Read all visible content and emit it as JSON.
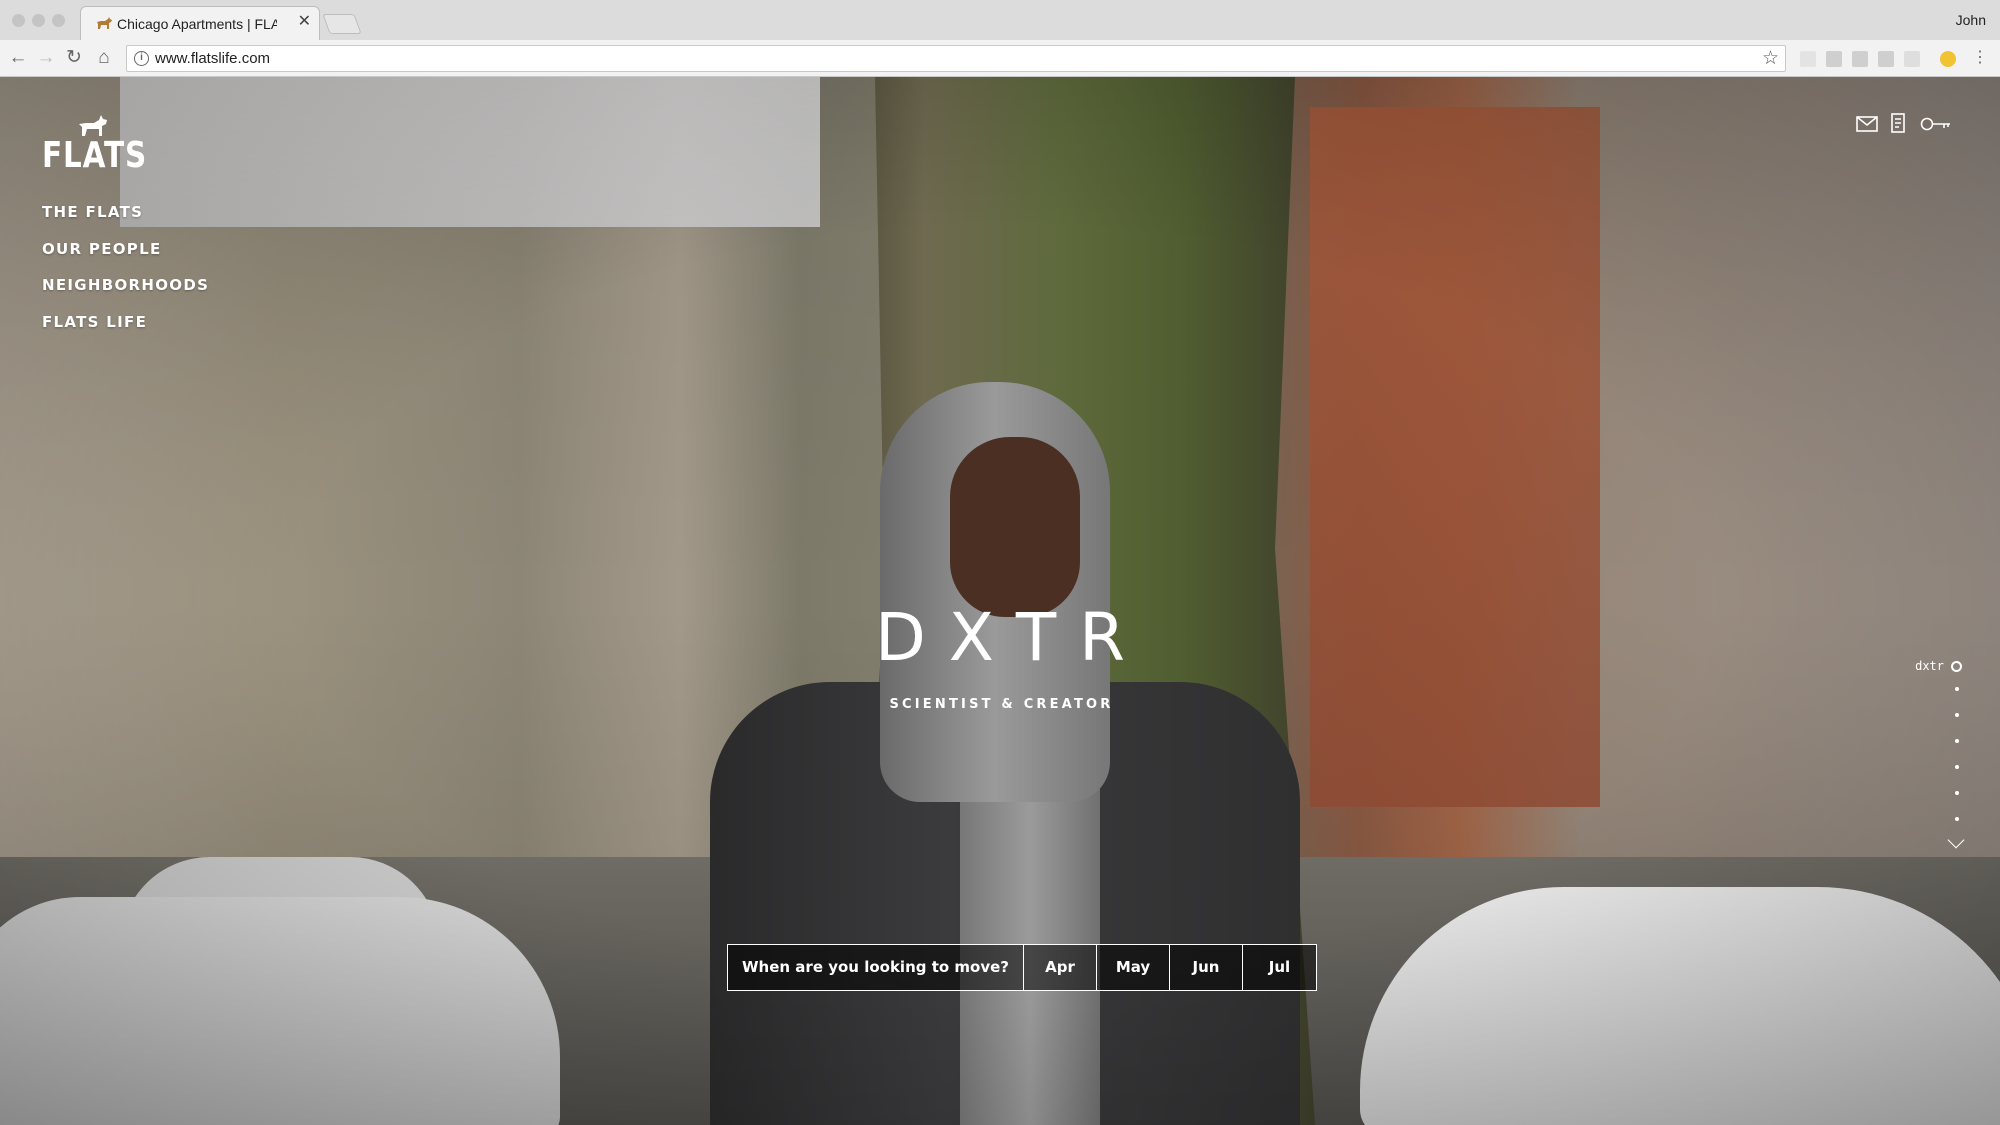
{
  "browser": {
    "tab_title": "Chicago Apartments | FLATS Chicago",
    "profile_name": "John",
    "url": "www.flatslife.com"
  },
  "site": {
    "logo_text": "FLATS",
    "nav": [
      {
        "label": "THE FLATS"
      },
      {
        "label": "OUR PEOPLE"
      },
      {
        "label": "NEIGHBORHOODS"
      },
      {
        "label": "FLATS LIFE"
      }
    ],
    "top_icons": [
      "mail-icon",
      "document-icon",
      "key-icon"
    ]
  },
  "hero": {
    "title": "DXTR",
    "subtitle": "SCIENTIST & CREATOR"
  },
  "pager": {
    "current_label": "dxtr",
    "dot_count": 6
  },
  "move_in": {
    "question": "When are you looking to move?",
    "months": [
      {
        "label": "Apr"
      },
      {
        "label": "May"
      },
      {
        "label": "Jun"
      },
      {
        "label": "Jul"
      }
    ]
  },
  "colors": {
    "overlay_text": "#ffffff",
    "move_bar_bg": "#000000"
  }
}
